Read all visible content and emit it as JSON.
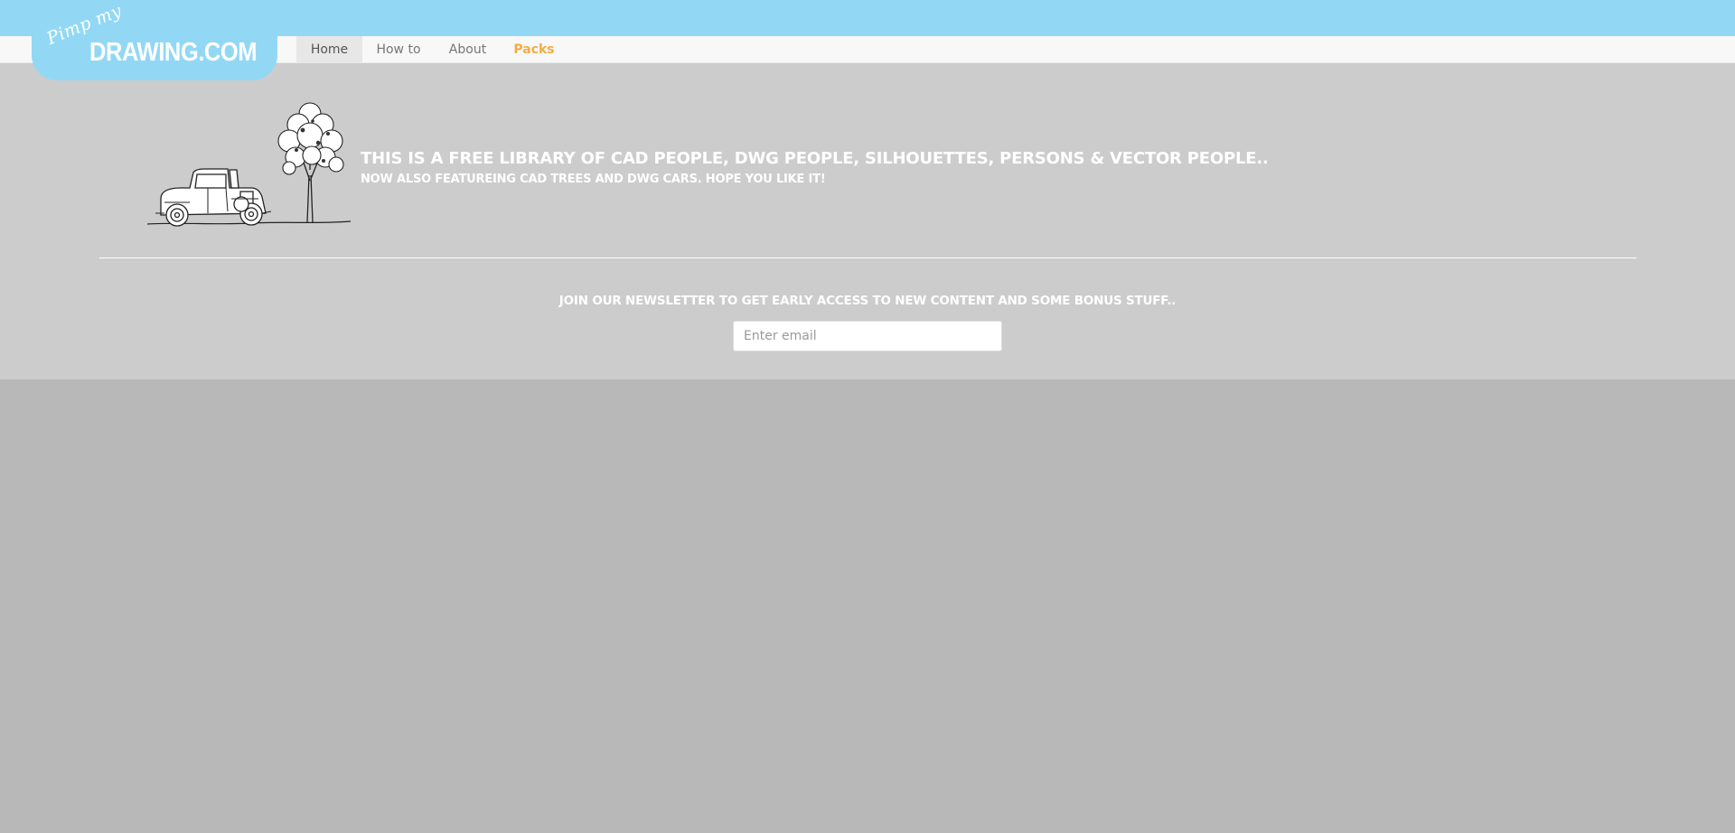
{
  "brand": {
    "script_text": "Pimp my",
    "main_text": "DRAWING.COM"
  },
  "nav": {
    "items": [
      {
        "label": "Home",
        "active": true
      },
      {
        "label": "How to",
        "active": false
      },
      {
        "label": "About",
        "active": false
      },
      {
        "label": "Packs",
        "active": false,
        "highlight": true
      }
    ]
  },
  "hero": {
    "headline": "THIS IS A FREE LIBRARY OF CAD PEOPLE, DWG PEOPLE, SILHOUETTES, PERSONS & VECTOR PEOPLE..",
    "subheadline": "NOW ALSO FEATUREING CAD TREES AND DWG CARS. HOPE YOU LIKE IT!",
    "illustration_icon": "car-and-tree-illustration"
  },
  "newsletter": {
    "text": "JOIN OUR NEWSLETTER TO GET EARLY ACCESS TO NEW CONTENT AND SOME BONUS STUFF..",
    "email_value": "",
    "email_placeholder": "Enter email"
  },
  "colors": {
    "sky_blue": "#92d8f5",
    "hero_bg": "#cccccc",
    "page_bg": "#b8b8b8",
    "packs_accent": "#f4ad42",
    "white": "#ffffff"
  }
}
